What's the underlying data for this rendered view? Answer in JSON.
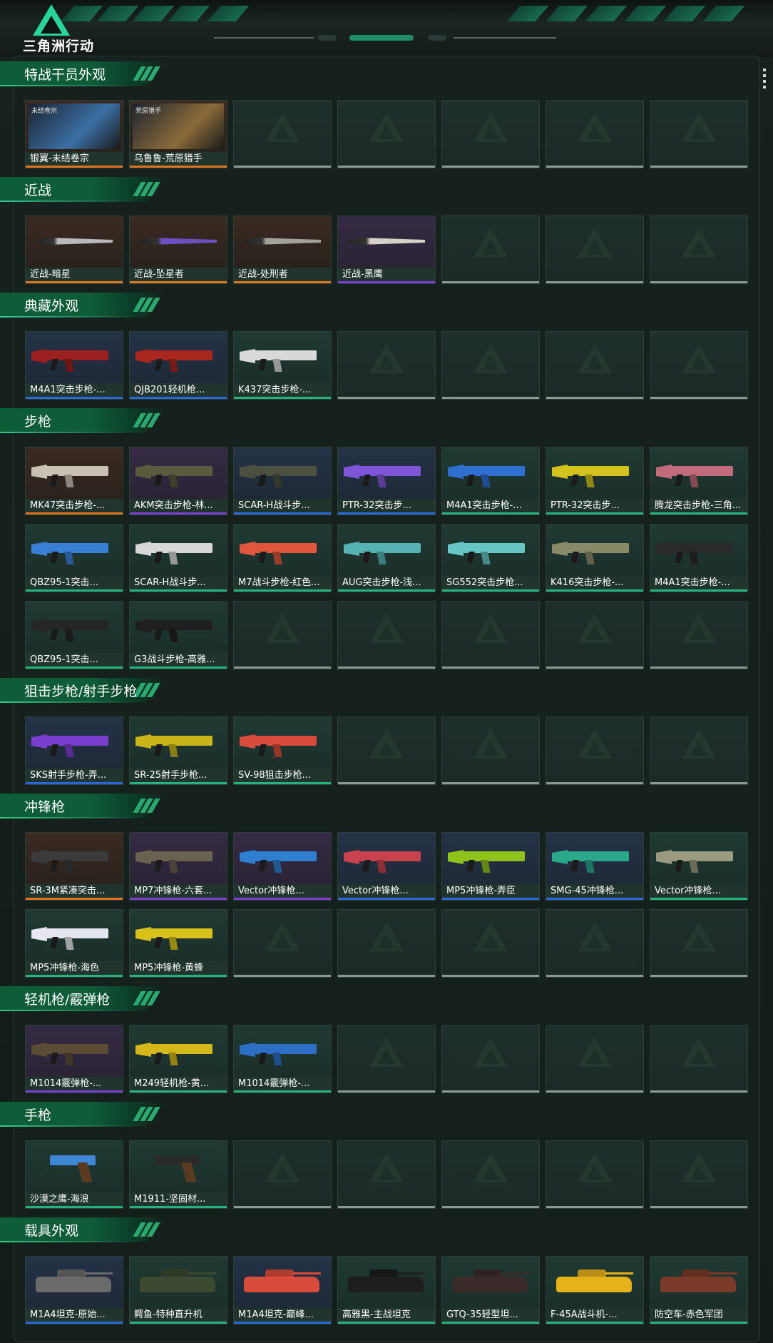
{
  "app": {
    "logo_text": "三角洲行动"
  },
  "colors": {
    "accent": "#27d49a",
    "rarity_orange": "#e0741d",
    "rarity_purple": "#7a3fd0",
    "rarity_blue": "#2a6ad8",
    "rarity_green": "#25b37c",
    "empty_bar": "#8b9995"
  },
  "sections": [
    {
      "title": "特战干员外观",
      "rows": [
        [
          {
            "name": "银翼-未结卷宗",
            "rarity": "orange",
            "kind": "portrait",
            "tag": "未结卷宗",
            "color": "#3b6fa4"
          },
          {
            "name": "乌鲁鲁-荒原猎手",
            "rarity": "orange",
            "kind": "portrait",
            "tag": "荒原猎手",
            "color": "#8b6b3a"
          },
          null,
          null,
          null,
          null,
          null
        ]
      ]
    },
    {
      "title": "近战",
      "rows": [
        [
          {
            "name": "近战-暗星",
            "rarity": "orange",
            "kind": "knife",
            "color": "#b9b9bc"
          },
          {
            "name": "近战-坠星者",
            "rarity": "orange",
            "kind": "knife",
            "color": "#6a4fc0"
          },
          {
            "name": "近战-处刑者",
            "rarity": "orange",
            "kind": "knife",
            "color": "#a3a19c"
          },
          {
            "name": "近战-黑鹰",
            "rarity": "purple",
            "kind": "knife",
            "color": "#d8cfc8"
          },
          null,
          null,
          null
        ]
      ]
    },
    {
      "title": "典藏外观",
      "rows": [
        [
          {
            "name": "M4A1突击步枪-...",
            "rarity": "blue",
            "kind": "gun",
            "color": "#9c1f1f"
          },
          {
            "name": "QJB201轻机枪...",
            "rarity": "blue",
            "kind": "gun",
            "color": "#a8261e"
          },
          {
            "name": "K437突击步枪-...",
            "rarity": "green",
            "kind": "gun",
            "color": "#d9d9d9"
          },
          null,
          null,
          null,
          null
        ]
      ]
    },
    {
      "title": "步枪",
      "rows": [
        [
          {
            "name": "MK47突击步枪-...",
            "rarity": "orange",
            "kind": "gun",
            "color": "#c9c1b3"
          },
          {
            "name": "AKM突击步枪-林...",
            "rarity": "purple",
            "kind": "gun",
            "color": "#5b5a3d"
          },
          {
            "name": "SCAR-H战斗步...",
            "rarity": "blue",
            "kind": "gun",
            "color": "#4c5040"
          },
          {
            "name": "PTR-32突击步...",
            "rarity": "blue",
            "kind": "gun",
            "color": "#7e55d6"
          },
          {
            "name": "M4A1突击步枪-...",
            "rarity": "green",
            "kind": "gun",
            "color": "#2f6fd0"
          },
          {
            "name": "PTR-32突击步...",
            "rarity": "green",
            "kind": "gun",
            "color": "#d2c21b"
          },
          {
            "name": "腾龙突击步枪-三角...",
            "rarity": "green",
            "kind": "gun",
            "color": "#c16a7a"
          }
        ],
        [
          {
            "name": "QBZ95-1突击...",
            "rarity": "green",
            "kind": "gun",
            "color": "#3a7fd6"
          },
          {
            "name": "SCAR-H战斗步...",
            "rarity": "green",
            "kind": "gun",
            "color": "#d7d7d7"
          },
          {
            "name": "M7战斗步枪-红色...",
            "rarity": "green",
            "kind": "gun",
            "color": "#e0553e"
          },
          {
            "name": "AUG突击步枪-浅...",
            "rarity": "green",
            "kind": "gun",
            "color": "#57b3b3"
          },
          {
            "name": "SG552突击步枪...",
            "rarity": "green",
            "kind": "gun",
            "color": "#66c6c3"
          },
          {
            "name": "K416突击步枪-...",
            "rarity": "green",
            "kind": "gun",
            "color": "#8a8a6a"
          },
          {
            "name": "M4A1突击步枪-...",
            "rarity": "green",
            "kind": "gun",
            "color": "#2a2a2a"
          }
        ],
        [
          {
            "name": "QBZ95-1突击...",
            "rarity": "green",
            "kind": "gun",
            "color": "#262626"
          },
          {
            "name": "G3战斗步枪-高雅...",
            "rarity": "green",
            "kind": "gun",
            "color": "#1f1f1f"
          },
          null,
          null,
          null,
          null,
          null
        ]
      ]
    },
    {
      "title": "狙击步枪/射手步枪",
      "rows": [
        [
          {
            "name": "SKS射手步枪-弄...",
            "rarity": "blue",
            "kind": "gun",
            "color": "#7b3fd0"
          },
          {
            "name": "SR-25射手步枪...",
            "rarity": "green",
            "kind": "gun",
            "color": "#c9b41a"
          },
          {
            "name": "SV-98狙击步枪...",
            "rarity": "green",
            "kind": "gun",
            "color": "#d94b3b"
          },
          null,
          null,
          null,
          null
        ]
      ]
    },
    {
      "title": "冲锋枪",
      "rows": [
        [
          {
            "name": "SR-3M紧凑突击...",
            "rarity": "orange",
            "kind": "gun",
            "color": "#3b3b3b"
          },
          {
            "name": "MP7冲锋枪-六套...",
            "rarity": "purple",
            "kind": "gun",
            "color": "#6a6250"
          },
          {
            "name": "Vector冲锋枪...",
            "rarity": "purple",
            "kind": "gun",
            "color": "#2f7fd0"
          },
          {
            "name": "Vector冲锋枪...",
            "rarity": "blue",
            "kind": "gun",
            "color": "#c7424c"
          },
          {
            "name": "MP5冲锋枪-弄臣",
            "rarity": "blue",
            "kind": "gun",
            "color": "#8fc21a"
          },
          {
            "name": "SMG-45冲锋枪...",
            "rarity": "blue",
            "kind": "gun",
            "color": "#2aa88a"
          },
          {
            "name": "Vector冲锋枪...",
            "rarity": "green",
            "kind": "gun",
            "color": "#9a9a80"
          }
        ],
        [
          {
            "name": "MP5冲锋枪-海色",
            "rarity": "green",
            "kind": "gun",
            "color": "#e6e6f0"
          },
          {
            "name": "MP5冲锋枪-黄蜂",
            "rarity": "green",
            "kind": "gun",
            "color": "#d8c21a"
          },
          null,
          null,
          null,
          null,
          null
        ]
      ]
    },
    {
      "title": "轻机枪/霰弹枪",
      "rows": [
        [
          {
            "name": "M1014霰弹枪-...",
            "rarity": "purple",
            "kind": "gun",
            "color": "#5b4d35"
          },
          {
            "name": "M249轻机枪-黄...",
            "rarity": "green",
            "kind": "gun",
            "color": "#d4b81a"
          },
          {
            "name": "M1014霰弹枪-...",
            "rarity": "green",
            "kind": "gun",
            "color": "#2e6fc6"
          },
          null,
          null,
          null,
          null
        ]
      ]
    },
    {
      "title": "手枪",
      "rows": [
        [
          {
            "name": "沙漠之鹰-海浪",
            "rarity": "green",
            "kind": "pistol",
            "color": "#3e86d6"
          },
          {
            "name": "M1911-坚固材...",
            "rarity": "green",
            "kind": "pistol",
            "color": "#2a2a2a"
          },
          null,
          null,
          null,
          null,
          null
        ]
      ]
    },
    {
      "title": "载具外观",
      "rows": [
        [
          {
            "name": "M1A4坦克-原始...",
            "rarity": "blue",
            "kind": "vehicle",
            "color": "#6a6a6a"
          },
          {
            "name": "鳄鱼-特种直升机",
            "rarity": "green",
            "kind": "vehicle",
            "color": "#3b4a30"
          },
          {
            "name": "M1A4坦克-巅峰...",
            "rarity": "blue",
            "kind": "vehicle",
            "color": "#d94b3b"
          },
          {
            "name": "高雅黑-主战坦克",
            "rarity": "green",
            "kind": "vehicle",
            "color": "#1e1e1e"
          },
          {
            "name": "GTQ-35轻型坦...",
            "rarity": "green",
            "kind": "vehicle",
            "color": "#3a2a2a"
          },
          {
            "name": "F-45A战斗机-...",
            "rarity": "green",
            "kind": "vehicle",
            "color": "#e6b21a"
          },
          {
            "name": "防空车-赤色军团",
            "rarity": "green",
            "kind": "vehicle",
            "color": "#7a3a2a"
          }
        ]
      ]
    }
  ]
}
